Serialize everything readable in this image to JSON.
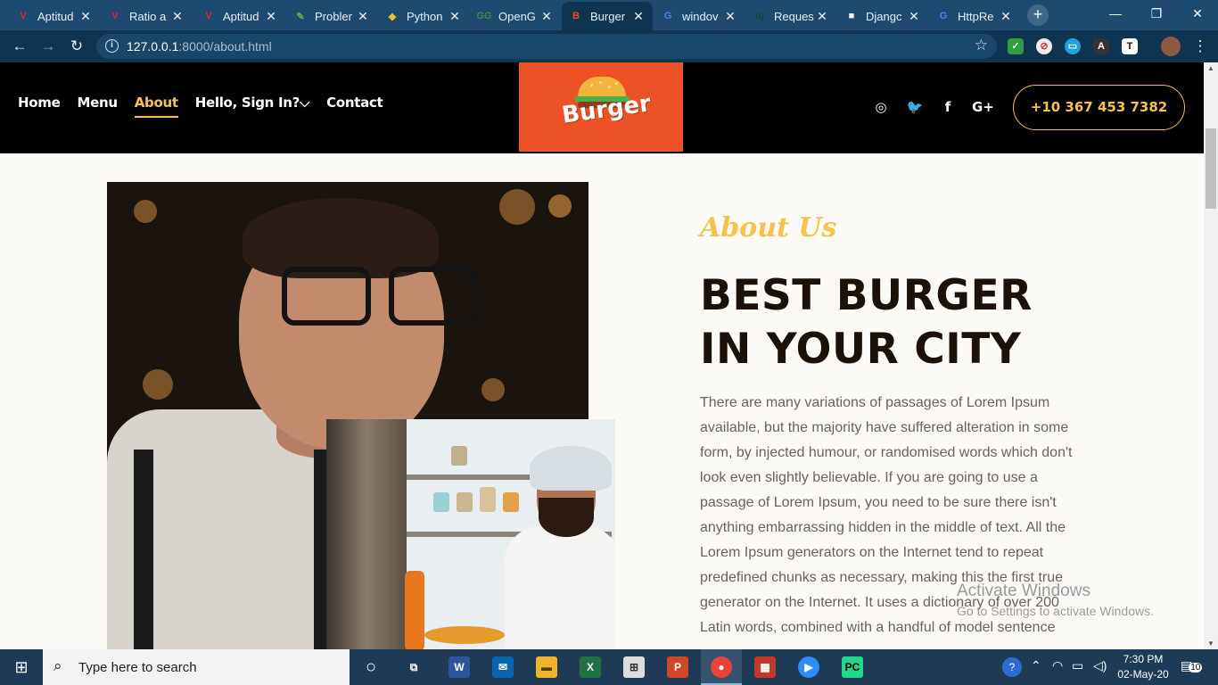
{
  "browser": {
    "tabs": [
      {
        "title": "Aptitud",
        "icon": "V",
        "icon_color": "#e4262a"
      },
      {
        "title": "Ratio a",
        "icon": "V",
        "icon_color": "#e4262a"
      },
      {
        "title": "Aptitud",
        "icon": "V",
        "icon_color": "#e4262a"
      },
      {
        "title": "Probler",
        "icon": "✎",
        "icon_color": "#6aa84f"
      },
      {
        "title": "Python",
        "icon": "◆",
        "icon_color": "#f2c21c"
      },
      {
        "title": "OpenG",
        "icon": "GG",
        "icon_color": "#2f8d46"
      },
      {
        "title": "Burger",
        "icon": "B",
        "icon_color": "#ec5226"
      },
      {
        "title": "windov",
        "icon": "G",
        "icon_color": "#4285f4"
      },
      {
        "title": "Reques",
        "icon": "dj",
        "icon_color": "#0c4b33"
      },
      {
        "title": "Djangc",
        "icon": "■",
        "icon_color": "#ffffff"
      },
      {
        "title": "HttpRe",
        "icon": "G",
        "icon_color": "#4285f4"
      }
    ],
    "active_tab_index": 6,
    "url_host": "127.0.0.1",
    "url_rest": ":8000/about.html"
  },
  "site": {
    "nav": [
      {
        "label": "Home"
      },
      {
        "label": "Menu"
      },
      {
        "label": "About",
        "active": true
      },
      {
        "label": "Hello, Sign In?⌵"
      },
      {
        "label": "Contact"
      }
    ],
    "logo_text": "Burger",
    "social_icons": [
      "instagram-icon",
      "twitter-icon",
      "facebook-icon",
      "google-plus-icon"
    ],
    "social_glyphs": [
      "◎",
      "🐦",
      "f",
      "G+"
    ],
    "phone": "+10 367 453 7382",
    "accent_color": "#f5c24d",
    "brand_color": "#ec5226"
  },
  "about": {
    "subtitle": "About Us",
    "headline_line1": "BEST BURGER",
    "headline_line2": "IN YOUR CITY",
    "paragraph": "There are many variations of passages of Lorem Ipsum available, but the majority have suffered alteration in some form, by injected humour, or randomised words which don't look even slightly believable. If you are going to use a passage of Lorem Ipsum, you need to be sure there isn't anything embarrassing hidden in the middle of text. All the Lorem Ipsum generators on the Internet tend to repeat predefined chunks as necessary, making this the first true generator on the Internet. It uses a dictionary of over 200 Latin words, combined with a handful of model sentence"
  },
  "watermark": {
    "line1": "Activate Windows",
    "line2": "Go to Settings to activate Windows."
  },
  "taskbar": {
    "search_placeholder": "Type here to search",
    "time": "7:30 PM",
    "date": "02-May-20",
    "notification_count": "10"
  }
}
